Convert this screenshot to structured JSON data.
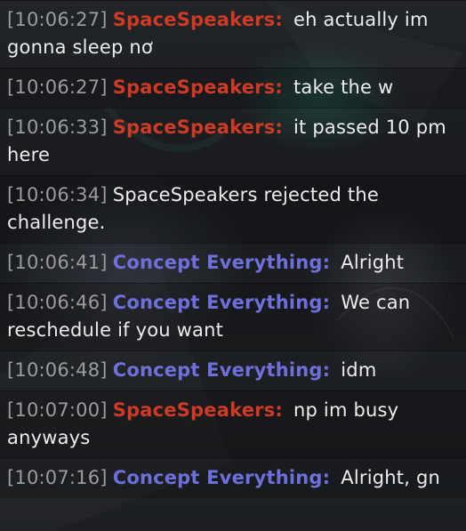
{
  "messages": [
    {
      "time": "[10:06:27]",
      "user": "SpaceSpeakers:",
      "text": "eh actually im gonna sleep nơ",
      "type": "space"
    },
    {
      "time": "[10:06:27]",
      "user": "SpaceSpeakers:",
      "text": "take the w",
      "type": "space"
    },
    {
      "time": "[10:06:33]",
      "user": "SpaceSpeakers:",
      "text": "it passed 10 pm here",
      "type": "space"
    },
    {
      "time": "[10:06:34]",
      "user": "",
      "text": "SpaceSpeakers rejected the challenge.",
      "type": "system"
    },
    {
      "time": "[10:06:41]",
      "user": "Concept Everything:",
      "text": "Alright",
      "type": "concept"
    },
    {
      "time": "[10:06:46]",
      "user": "Concept Everything:",
      "text": "We can reschedule if you want",
      "type": "concept"
    },
    {
      "time": "[10:06:48]",
      "user": "Concept Everything:",
      "text": "idm",
      "type": "concept"
    },
    {
      "time": "[10:07:00]",
      "user": "SpaceSpeakers:",
      "text": "np im busy anyways",
      "type": "space"
    },
    {
      "time": "[10:07:16]",
      "user": "Concept Everything:",
      "text": "Alright, gn",
      "type": "concept"
    }
  ],
  "colors": {
    "space_user": "#cf3a25",
    "concept_user": "#6f6fdc",
    "timestamp": "#9c9c9c",
    "message_text": "#ececec"
  }
}
